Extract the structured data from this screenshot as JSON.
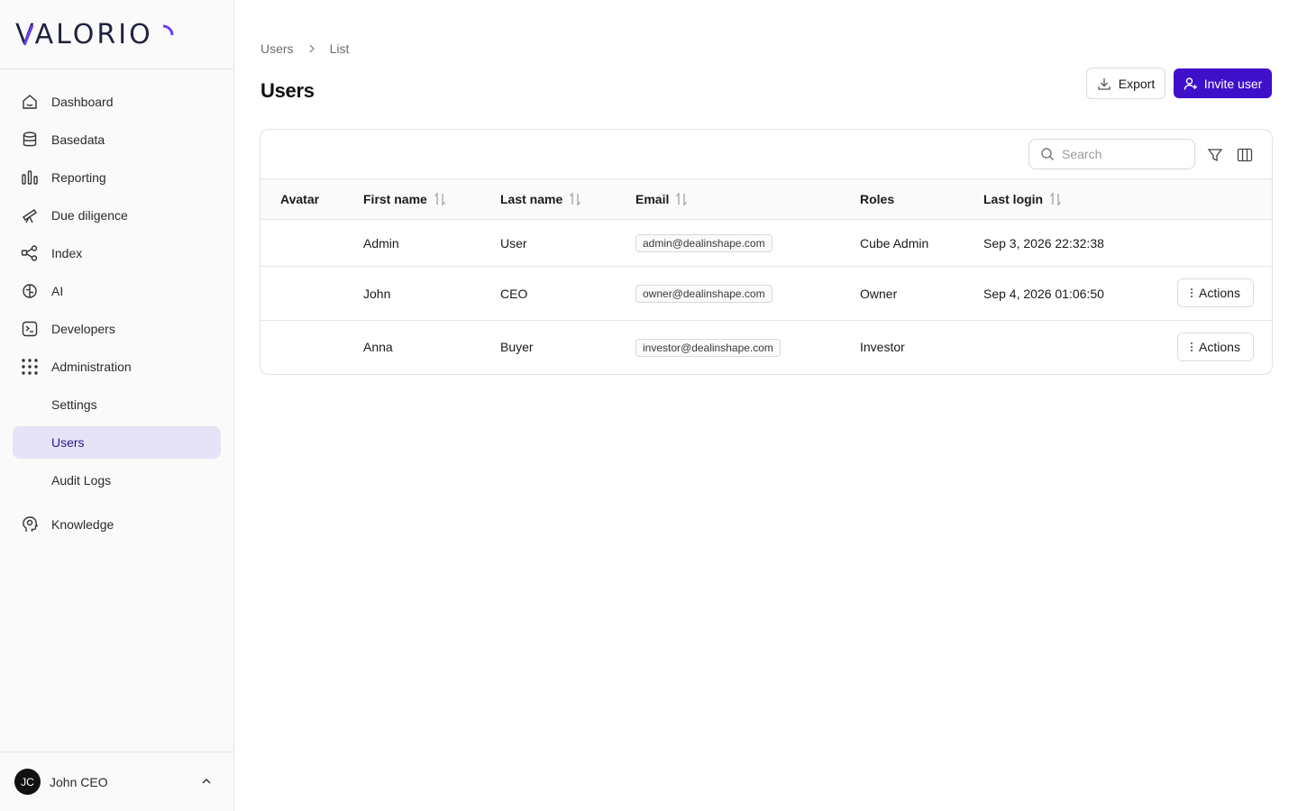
{
  "brand": {
    "logo_text": "VALORIO",
    "accent_color": "#3f10c9"
  },
  "sidebar": {
    "items": [
      {
        "label": "Dashboard",
        "icon": "home-icon"
      },
      {
        "label": "Basedata",
        "icon": "database-icon"
      },
      {
        "label": "Reporting",
        "icon": "bar-chart-icon"
      },
      {
        "label": "Due diligence",
        "icon": "telescope-icon"
      },
      {
        "label": "Index",
        "icon": "share-nodes-icon"
      },
      {
        "label": "AI",
        "icon": "brain-icon"
      },
      {
        "label": "Developers",
        "icon": "terminal-icon"
      },
      {
        "label": "Administration",
        "icon": "grid-dots-icon"
      },
      {
        "label": "Settings"
      },
      {
        "label": "Users",
        "active": true
      },
      {
        "label": "Audit Logs"
      },
      {
        "label": "Knowledge",
        "icon": "head-icon"
      }
    ],
    "user": {
      "initials": "JC",
      "name": "John CEO"
    }
  },
  "breadcrumb": {
    "items": [
      "Users",
      "List"
    ]
  },
  "page": {
    "title": "Users"
  },
  "actions": {
    "export_label": "Export",
    "invite_label": "Invite user"
  },
  "search": {
    "placeholder": "Search"
  },
  "table": {
    "columns": [
      "Avatar",
      "First name",
      "Last name",
      "Email",
      "Roles",
      "Last login"
    ],
    "rows": [
      {
        "first": "Admin",
        "last": "User",
        "email": "admin@dealinshape.com",
        "role": "Cube Admin",
        "last_login": "Sep 3, 2026 22:32:38",
        "actions": ""
      },
      {
        "first": "John",
        "last": "CEO",
        "email": "owner@dealinshape.com",
        "role": "Owner",
        "last_login": "Sep 4, 2026 01:06:50",
        "actions": "Actions"
      },
      {
        "first": "Anna",
        "last": "Buyer",
        "email": "investor@dealinshape.com",
        "role": "Investor",
        "last_login": "",
        "actions": "Actions"
      }
    ]
  }
}
